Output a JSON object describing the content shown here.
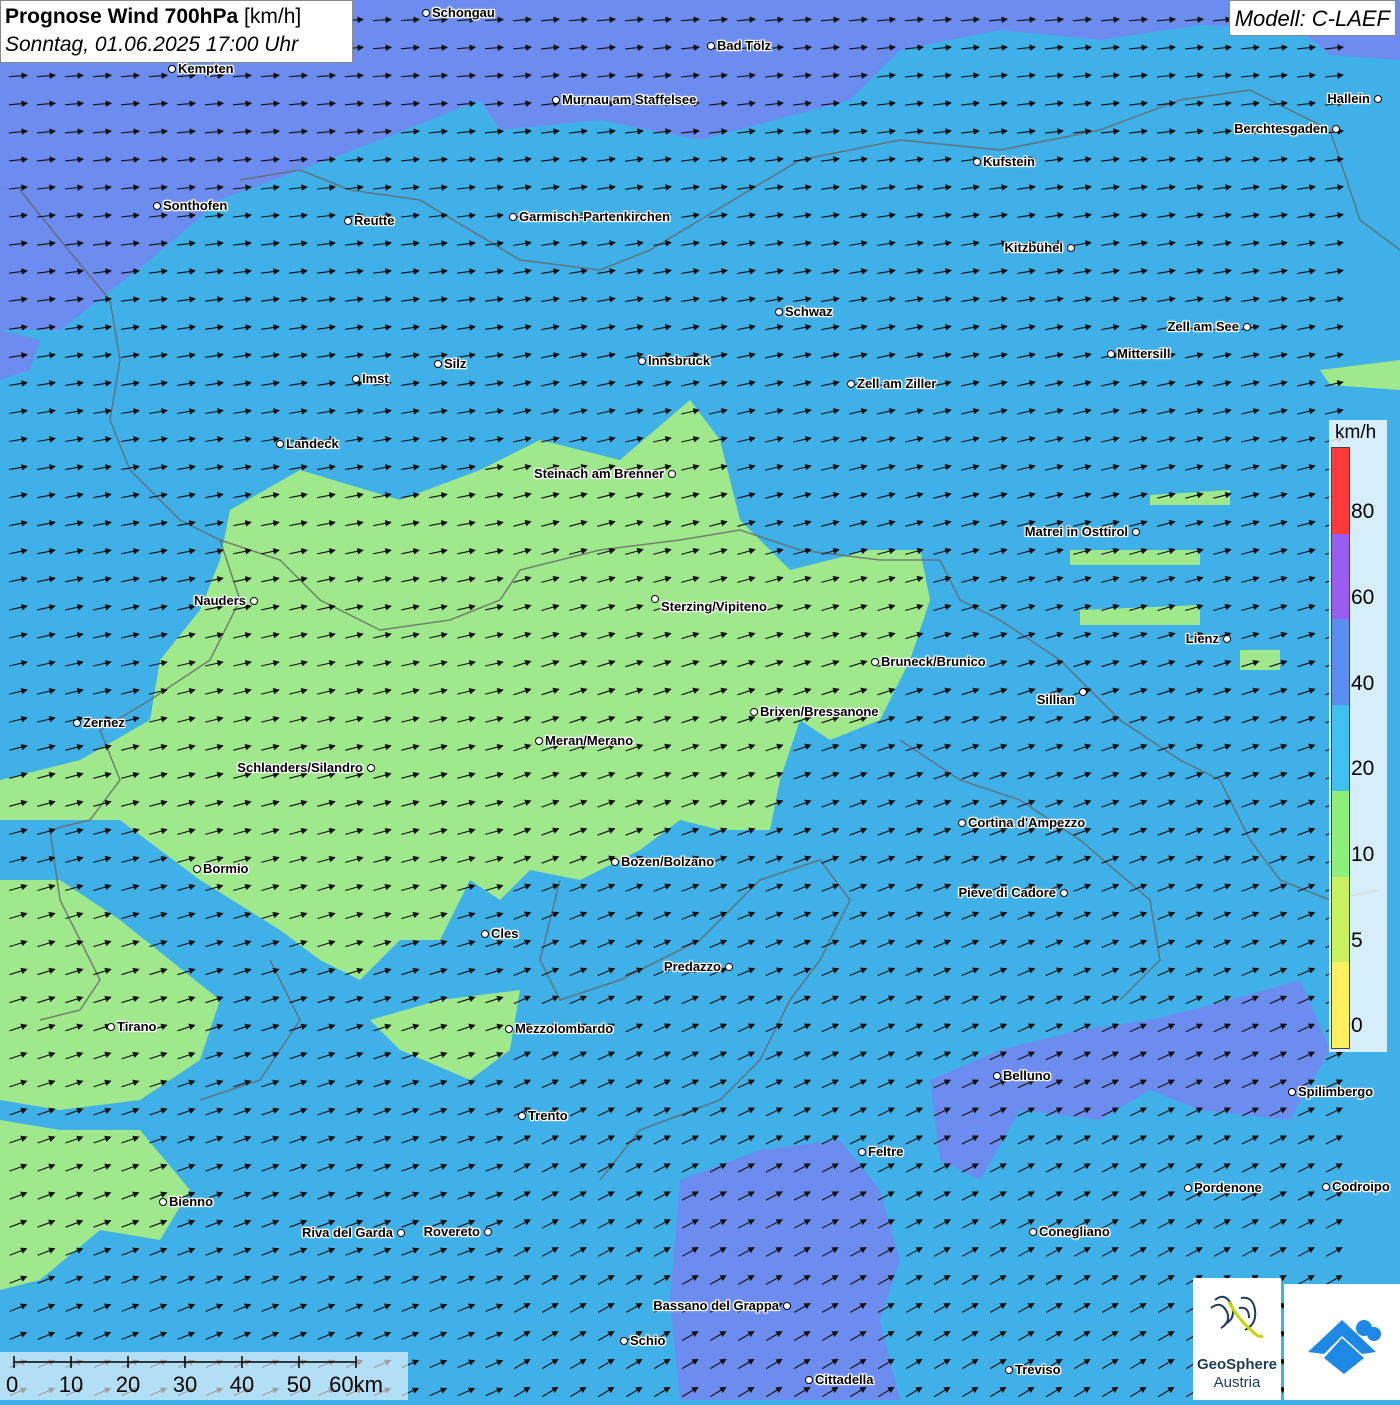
{
  "header": {
    "title_bold": "Prognose Wind 700hPa",
    "title_unit": "[km/h]",
    "datetime": "Sonntag, 01.06.2025 17:00 Uhr",
    "model": "Modell: C-LAEF"
  },
  "legend": {
    "unit": "km/h",
    "ticks": [
      "80",
      "60",
      "40",
      "20",
      "10",
      "5",
      "0"
    ],
    "colors": [
      "#ff3a3a",
      "#9b5cf0",
      "#5b8df0",
      "#3fc0f0",
      "#8ef07a",
      "#c8f060",
      "#fff060"
    ]
  },
  "map_colors": {
    "ocean_blue": "#3fb0e8",
    "violet_blue": "#6d8cf0",
    "green": "#9fe88c",
    "yellow_green": "#c8f060"
  },
  "scale_bar": {
    "labels": [
      "0",
      "10",
      "20",
      "30",
      "40",
      "50",
      "60km"
    ]
  },
  "cities": [
    {
      "name": "Schongau"
    },
    {
      "name": "Bad Tölz"
    },
    {
      "name": "Kempten"
    },
    {
      "name": "Murnau am Staffelsee"
    },
    {
      "name": "Hallein"
    },
    {
      "name": "Berchtesgaden"
    },
    {
      "name": "Kufstein"
    },
    {
      "name": "Sonthofen"
    },
    {
      "name": "Reutte"
    },
    {
      "name": "Garmisch-Partenkirchen"
    },
    {
      "name": "Kitzbühel"
    },
    {
      "name": "Schwaz"
    },
    {
      "name": "Zell am See"
    },
    {
      "name": "Mittersill"
    },
    {
      "name": "Imst"
    },
    {
      "name": "Silz"
    },
    {
      "name": "Innsbruck"
    },
    {
      "name": "Zell am Ziller"
    },
    {
      "name": "Landeck"
    },
    {
      "name": "Steinach am Brenner"
    },
    {
      "name": "Matrei in Osttirol"
    },
    {
      "name": "Nauders"
    },
    {
      "name": "Sterzing/Vipiteno"
    },
    {
      "name": "Lienz"
    },
    {
      "name": "Bruneck/Brunico"
    },
    {
      "name": "Sillian"
    },
    {
      "name": "Zernez"
    },
    {
      "name": "Brixen/Bressanone"
    },
    {
      "name": "Meran/Merano"
    },
    {
      "name": "Schlanders/Silandro"
    },
    {
      "name": "Cortina d'Ampezzo"
    },
    {
      "name": "Bozen/Bolzano"
    },
    {
      "name": "Bormio"
    },
    {
      "name": "Pieve di Cadore"
    },
    {
      "name": "Cles"
    },
    {
      "name": "Predazzo"
    },
    {
      "name": "Tirano"
    },
    {
      "name": "Mezzolombardo"
    },
    {
      "name": "Belluno"
    },
    {
      "name": "Spilimbergo"
    },
    {
      "name": "Trento"
    },
    {
      "name": "Feltre"
    },
    {
      "name": "Pordenone"
    },
    {
      "name": "Codroipo"
    },
    {
      "name": "Bienno"
    },
    {
      "name": "Riva del Garda"
    },
    {
      "name": "Rovereto"
    },
    {
      "name": "Conegliano"
    },
    {
      "name": "Bassano del Grappa"
    },
    {
      "name": "Schio"
    },
    {
      "name": "Treviso"
    },
    {
      "name": "Cittadella"
    }
  ],
  "logos": {
    "geosphere_line1": "GeoSphere",
    "geosphere_line2": "Austria"
  }
}
